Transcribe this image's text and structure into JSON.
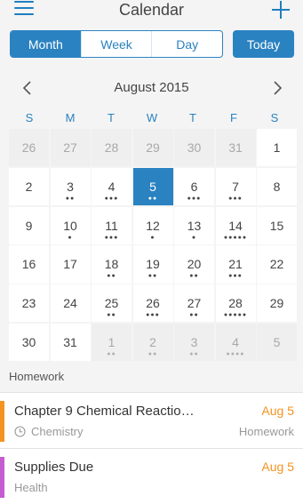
{
  "header": {
    "title": "Calendar"
  },
  "view_tabs": [
    {
      "label": "Month",
      "active": true
    },
    {
      "label": "Week",
      "active": false
    },
    {
      "label": "Day",
      "active": false
    }
  ],
  "today_label": "Today",
  "month": {
    "label": "August 2015"
  },
  "weekdays": [
    "S",
    "M",
    "T",
    "W",
    "T",
    "F",
    "S"
  ],
  "days": [
    {
      "n": "26",
      "out": true,
      "dots": 0
    },
    {
      "n": "27",
      "out": true,
      "dots": 0
    },
    {
      "n": "28",
      "out": true,
      "dots": 0
    },
    {
      "n": "29",
      "out": true,
      "dots": 0
    },
    {
      "n": "30",
      "out": true,
      "dots": 0
    },
    {
      "n": "31",
      "out": true,
      "dots": 0
    },
    {
      "n": "1",
      "out": false,
      "dots": 0
    },
    {
      "n": "2",
      "out": false,
      "dots": 0
    },
    {
      "n": "3",
      "out": false,
      "dots": 2
    },
    {
      "n": "4",
      "out": false,
      "dots": 3
    },
    {
      "n": "5",
      "out": false,
      "dots": 2,
      "selected": true
    },
    {
      "n": "6",
      "out": false,
      "dots": 3
    },
    {
      "n": "7",
      "out": false,
      "dots": 3
    },
    {
      "n": "8",
      "out": false,
      "dots": 0
    },
    {
      "n": "9",
      "out": false,
      "dots": 0
    },
    {
      "n": "10",
      "out": false,
      "dots": 1
    },
    {
      "n": "11",
      "out": false,
      "dots": 3
    },
    {
      "n": "12",
      "out": false,
      "dots": 1
    },
    {
      "n": "13",
      "out": false,
      "dots": 1
    },
    {
      "n": "14",
      "out": false,
      "dots": 5
    },
    {
      "n": "15",
      "out": false,
      "dots": 0
    },
    {
      "n": "16",
      "out": false,
      "dots": 0
    },
    {
      "n": "17",
      "out": false,
      "dots": 0
    },
    {
      "n": "18",
      "out": false,
      "dots": 2
    },
    {
      "n": "19",
      "out": false,
      "dots": 2
    },
    {
      "n": "20",
      "out": false,
      "dots": 2
    },
    {
      "n": "21",
      "out": false,
      "dots": 3
    },
    {
      "n": "22",
      "out": false,
      "dots": 0
    },
    {
      "n": "23",
      "out": false,
      "dots": 0
    },
    {
      "n": "24",
      "out": false,
      "dots": 0
    },
    {
      "n": "25",
      "out": false,
      "dots": 2
    },
    {
      "n": "26",
      "out": false,
      "dots": 3
    },
    {
      "n": "27",
      "out": false,
      "dots": 2
    },
    {
      "n": "28",
      "out": false,
      "dots": 5
    },
    {
      "n": "29",
      "out": false,
      "dots": 0
    },
    {
      "n": "30",
      "out": false,
      "dots": 0
    },
    {
      "n": "31",
      "out": false,
      "dots": 0
    },
    {
      "n": "1",
      "out": true,
      "dots": 2
    },
    {
      "n": "2",
      "out": true,
      "dots": 2
    },
    {
      "n": "3",
      "out": true,
      "dots": 2
    },
    {
      "n": "4",
      "out": true,
      "dots": 4
    },
    {
      "n": "5",
      "out": true,
      "dots": 0
    }
  ],
  "section_label": "Homework",
  "items": [
    {
      "title": "Chapter 9 Chemical Reactio…",
      "date": "Aug 5",
      "subject": "Chemistry",
      "category": "Homework",
      "color": "#f39322",
      "has_clock": true
    },
    {
      "title": "Supplies Due",
      "date": "Aug 5",
      "subject": "Health",
      "category": "",
      "color": "#c45dd0",
      "has_clock": false
    }
  ],
  "colors": {
    "accent": "#2a82c1",
    "date": "#f39322"
  }
}
